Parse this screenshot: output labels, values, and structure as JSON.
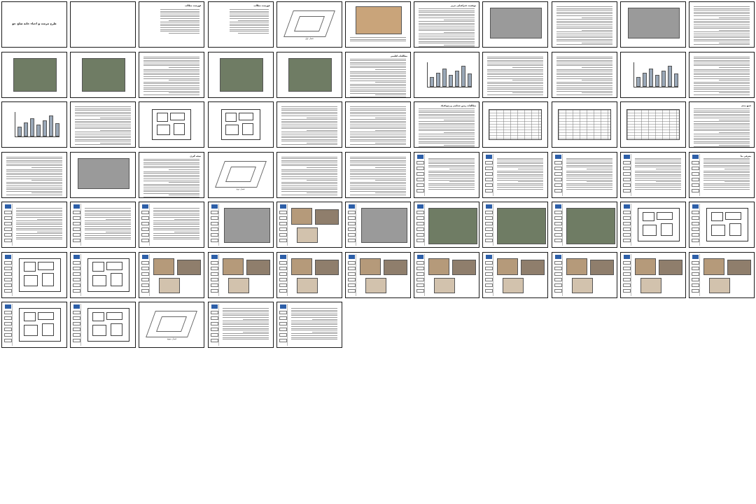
{
  "view": {
    "columns": 11,
    "rows": 7,
    "total_pages": 70
  },
  "pages": [
    {
      "kind": "cover",
      "title": "طرح مرمت و احیاء خانه صلح جو",
      "text": ""
    },
    {
      "kind": "blank"
    },
    {
      "kind": "toc",
      "title": "فهرست مطالب"
    },
    {
      "kind": "toc",
      "title": "فهرست مطالب"
    },
    {
      "kind": "iso",
      "title": "",
      "caption": "فصل اول"
    },
    {
      "kind": "mapc",
      "title": "",
      "caption": ""
    },
    {
      "kind": "text",
      "title": "موقعیت جغرافیایی تبریز"
    },
    {
      "kind": "map",
      "title": ""
    },
    {
      "kind": "text",
      "title": ""
    },
    {
      "kind": "map",
      "title": ""
    },
    {
      "kind": "text",
      "title": ""
    },
    {
      "kind": "sat",
      "title": ""
    },
    {
      "kind": "sat",
      "title": ""
    },
    {
      "kind": "text",
      "title": ""
    },
    {
      "kind": "sat",
      "title": ""
    },
    {
      "kind": "sat",
      "title": ""
    },
    {
      "kind": "text",
      "title": "مطالعات اقلیمی"
    },
    {
      "kind": "chart",
      "title": ""
    },
    {
      "kind": "text",
      "title": ""
    },
    {
      "kind": "text",
      "title": ""
    },
    {
      "kind": "chart",
      "title": ""
    },
    {
      "kind": "text",
      "title": ""
    },
    {
      "kind": "chart",
      "title": ""
    },
    {
      "kind": "text",
      "title": ""
    },
    {
      "kind": "plan",
      "title": ""
    },
    {
      "kind": "plan",
      "title": ""
    },
    {
      "kind": "text",
      "title": ""
    },
    {
      "kind": "text",
      "title": ""
    },
    {
      "kind": "text",
      "title": "مطالعات زمین شناسی و ژئوتکنیک"
    },
    {
      "kind": "table",
      "title": ""
    },
    {
      "kind": "table",
      "title": ""
    },
    {
      "kind": "table",
      "title": ""
    },
    {
      "kind": "text",
      "title": "جمع بندی"
    },
    {
      "kind": "text",
      "title": ""
    },
    {
      "kind": "map",
      "title": ""
    },
    {
      "kind": "text",
      "title": "نتیجه گیری"
    },
    {
      "kind": "iso",
      "title": "",
      "caption": "فصل دوم"
    },
    {
      "kind": "text",
      "title": ""
    },
    {
      "kind": "text",
      "title": ""
    },
    {
      "kind": "side",
      "title": ""
    },
    {
      "kind": "side",
      "title": ""
    },
    {
      "kind": "side",
      "title": ""
    },
    {
      "kind": "side",
      "title": ""
    },
    {
      "kind": "side",
      "title": "معرفی بنا"
    },
    {
      "kind": "side",
      "title": ""
    },
    {
      "kind": "side",
      "title": ""
    },
    {
      "kind": "side",
      "title": ""
    },
    {
      "kind": "sidemap",
      "title": ""
    },
    {
      "kind": "sidephoto",
      "title": ""
    },
    {
      "kind": "sidemap",
      "title": ""
    },
    {
      "kind": "sidesat",
      "title": ""
    },
    {
      "kind": "sidesat",
      "title": ""
    },
    {
      "kind": "sidesat",
      "title": ""
    },
    {
      "kind": "sideplan",
      "title": ""
    },
    {
      "kind": "sideplan",
      "title": ""
    },
    {
      "kind": "sideplan",
      "title": ""
    },
    {
      "kind": "sideplan",
      "title": ""
    },
    {
      "kind": "sidephoto",
      "title": ""
    },
    {
      "kind": "sidephoto",
      "title": ""
    },
    {
      "kind": "sidephoto",
      "title": ""
    },
    {
      "kind": "sidephoto",
      "title": ""
    },
    {
      "kind": "sidephoto",
      "title": ""
    },
    {
      "kind": "sidephoto",
      "title": ""
    },
    {
      "kind": "sidephoto",
      "title": ""
    },
    {
      "kind": "sidephoto",
      "title": ""
    },
    {
      "kind": "sidephoto",
      "title": ""
    },
    {
      "kind": "sideplan",
      "title": ""
    },
    {
      "kind": "sideplan",
      "title": ""
    },
    {
      "kind": "iso",
      "title": "",
      "caption": "فصل سوم"
    },
    {
      "kind": "side",
      "title": ""
    },
    {
      "kind": "side",
      "title": ""
    }
  ]
}
